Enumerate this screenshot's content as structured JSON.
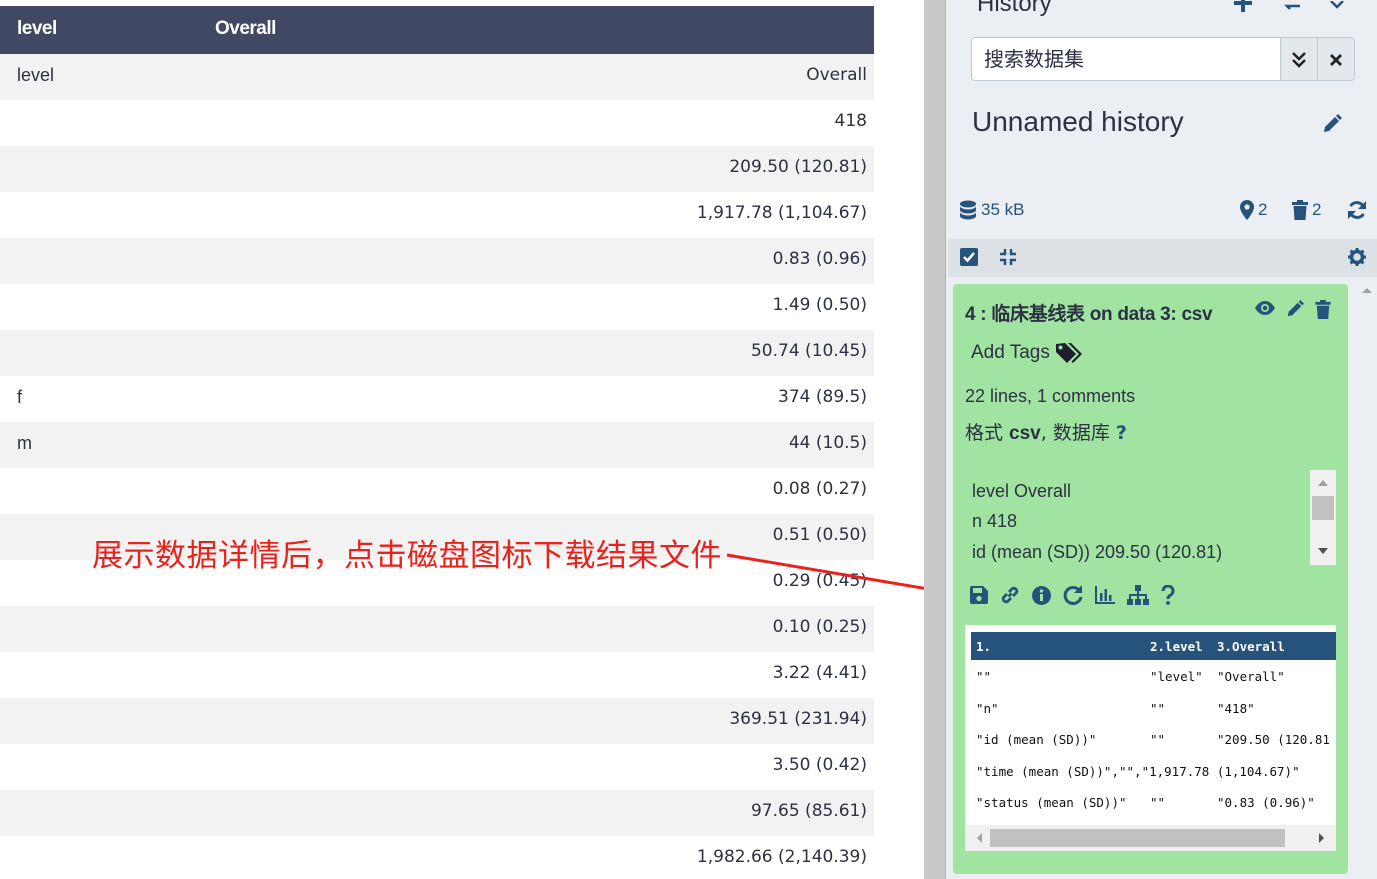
{
  "table": {
    "headers": [
      "level",
      "Overall"
    ],
    "rows": [
      [
        "level",
        "Overall"
      ],
      [
        "",
        "418"
      ],
      [
        "",
        "209.50 (120.81)"
      ],
      [
        "",
        "1,917.78 (1,104.67)"
      ],
      [
        "",
        "0.83 (0.96)"
      ],
      [
        "",
        "1.49 (0.50)"
      ],
      [
        "",
        "50.74 (10.45)"
      ],
      [
        "f",
        "374 (89.5)"
      ],
      [
        "m",
        "44 (10.5)"
      ],
      [
        "",
        "0.08 (0.27)"
      ],
      [
        "",
        "0.51 (0.50)"
      ],
      [
        "",
        "0.29 (0.45)"
      ],
      [
        "",
        "0.10 (0.25)"
      ],
      [
        "",
        "3.22 (4.41)"
      ],
      [
        "",
        "369.51 (231.94)"
      ],
      [
        "",
        "3.50 (0.42)"
      ],
      [
        "",
        "97.65 (85.61)"
      ],
      [
        "",
        "1,982.66 (2,140.39)"
      ]
    ]
  },
  "annotation": {
    "text": "展示数据详情后，点击磁盘图标下载结果文件",
    "color": "#e8231d"
  },
  "history": {
    "title": "History",
    "search_placeholder": "搜索数据集",
    "name": "Unnamed history",
    "size": "35 kB",
    "shown_count": "2",
    "deleted_count": "2"
  },
  "dataset": {
    "title": "4 : 临床基线表 on data 3: csv",
    "tags_label": "Add Tags",
    "lines": "22 lines, 1 comments",
    "format_prefix": "格式 ",
    "format": "csv",
    "db_prefix": ", 数据库 ",
    "db": "?",
    "peek": [
      "level Overall",
      "n 418",
      "id (mean (SD)) 209.50 (120.81)"
    ],
    "preview_headers": [
      "1.",
      "2.level",
      "3.Overall"
    ],
    "preview_rows": [
      [
        "\"\"",
        "\"level\"",
        "\"Overall\""
      ],
      [
        "\"n\"",
        "\"\"",
        "\"418\""
      ],
      [
        "\"id (mean (SD))\"",
        "\"\"",
        "\"209.50 (120.81"
      ],
      [
        "\"time (mean (SD))\",\"\",\"1,917.78 (1,104.67)\"",
        "",
        ""
      ],
      [
        "\"status (mean (SD))\"",
        "\"\"",
        "\"0.83 (0.96)\""
      ]
    ]
  },
  "colors": {
    "header_bg": "#414864",
    "card_bg": "#a1e3a1",
    "accent": "#25537b"
  }
}
